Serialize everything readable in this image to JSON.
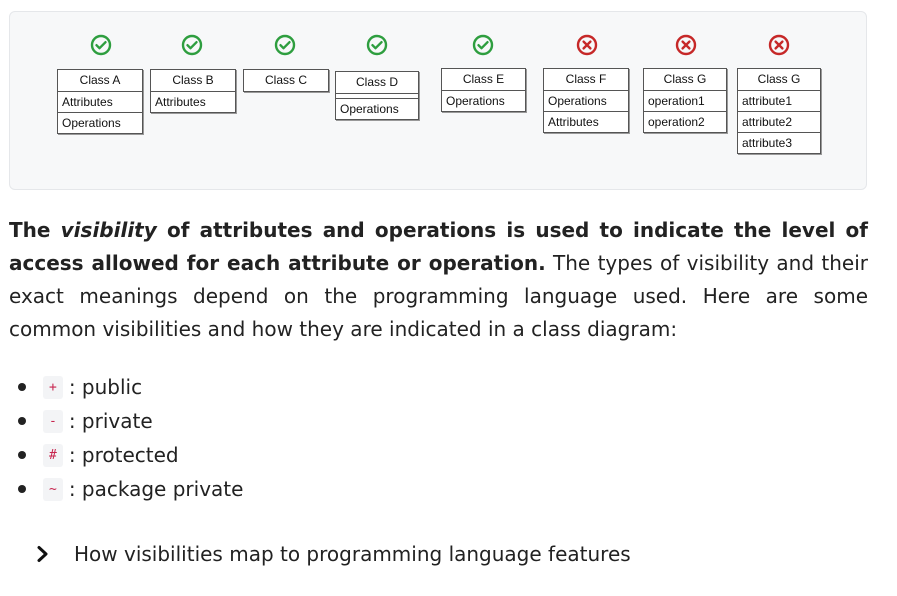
{
  "figure": {
    "classes": [
      {
        "status": "ok",
        "rows": [
          "Class A",
          "Attributes",
          "Operations"
        ]
      },
      {
        "status": "ok",
        "rows": [
          "Class B",
          "Attributes"
        ]
      },
      {
        "status": "ok",
        "rows": [
          "Class C"
        ]
      },
      {
        "status": "ok",
        "rows": [
          "Class D",
          "",
          "Operations"
        ]
      },
      {
        "status": "ok",
        "rows": [
          "Class E",
          "Operations"
        ]
      },
      {
        "status": "bad",
        "rows": [
          "Class F",
          "Operations",
          "Attributes"
        ]
      },
      {
        "status": "bad",
        "rows": [
          "Class G",
          "operation1",
          "operation2"
        ]
      },
      {
        "status": "bad",
        "rows": [
          "Class G",
          "attribute1",
          "attribute2",
          "attribute3"
        ]
      }
    ],
    "colors": {
      "ok": "#2e9e3f",
      "bad": "#c62828"
    }
  },
  "paragraph": {
    "bold_1": "The ",
    "bold_italic": "visibility",
    "bold_2": " of attributes and operations is used to indicate the level of access allowed for each attribute or operation.",
    "rest": " The types of visibility and their exact meanings depend on the programming language used. Here are some common visibilities and how they are indicated in a class diagram:"
  },
  "visibilities": [
    {
      "symbol": "+",
      "label": ": public"
    },
    {
      "symbol": "-",
      "label": ": private"
    },
    {
      "symbol": "#",
      "label": ": protected"
    },
    {
      "symbol": "~",
      "label": ": package private"
    }
  ],
  "details": {
    "label": "How visibilities map to programming language features"
  }
}
